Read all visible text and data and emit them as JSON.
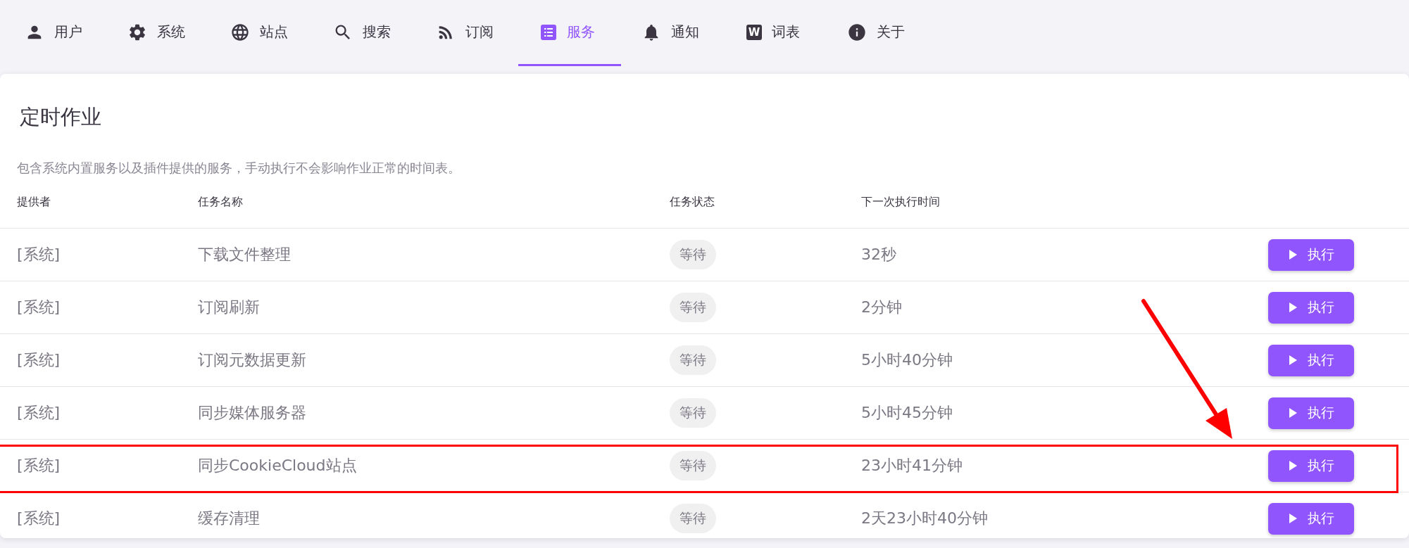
{
  "tabs": [
    {
      "label": "用户",
      "selected": false
    },
    {
      "label": "系统",
      "selected": false
    },
    {
      "label": "站点",
      "selected": false
    },
    {
      "label": "搜索",
      "selected": false
    },
    {
      "label": "订阅",
      "selected": false
    },
    {
      "label": "服务",
      "selected": true
    },
    {
      "label": "通知",
      "selected": false
    },
    {
      "label": "词表",
      "selected": false,
      "badge": "W"
    },
    {
      "label": "关于",
      "selected": false
    }
  ],
  "card": {
    "title": "定时作业",
    "description": "包含系统内置服务以及插件提供的服务，手动执行不会影响作业正常的时间表。",
    "table": {
      "columns": [
        "提供者",
        "任务名称",
        "任务状态",
        "下一次执行时间"
      ],
      "rows": [
        {
          "provider": "[系统]",
          "name": "下载文件整理",
          "status": "等待",
          "next_run": "32秒",
          "action": "执行",
          "highlighted": false
        },
        {
          "provider": "[系统]",
          "name": "订阅刷新",
          "status": "等待",
          "next_run": "2分钟",
          "action": "执行",
          "highlighted": false
        },
        {
          "provider": "[系统]",
          "name": "订阅元数据更新",
          "status": "等待",
          "next_run": "5小时40分钟",
          "action": "执行",
          "highlighted": false
        },
        {
          "provider": "[系统]",
          "name": "同步媒体服务器",
          "status": "等待",
          "next_run": "5小时45分钟",
          "action": "执行",
          "highlighted": false
        },
        {
          "provider": "[系统]",
          "name": "同步CookieCloud站点",
          "status": "等待",
          "next_run": "23小时41分钟",
          "action": "执行",
          "highlighted": true
        },
        {
          "provider": "[系统]",
          "name": "缓存清理",
          "status": "等待",
          "next_run": "2天23小时40分钟",
          "action": "执行",
          "highlighted": false
        }
      ]
    }
  }
}
